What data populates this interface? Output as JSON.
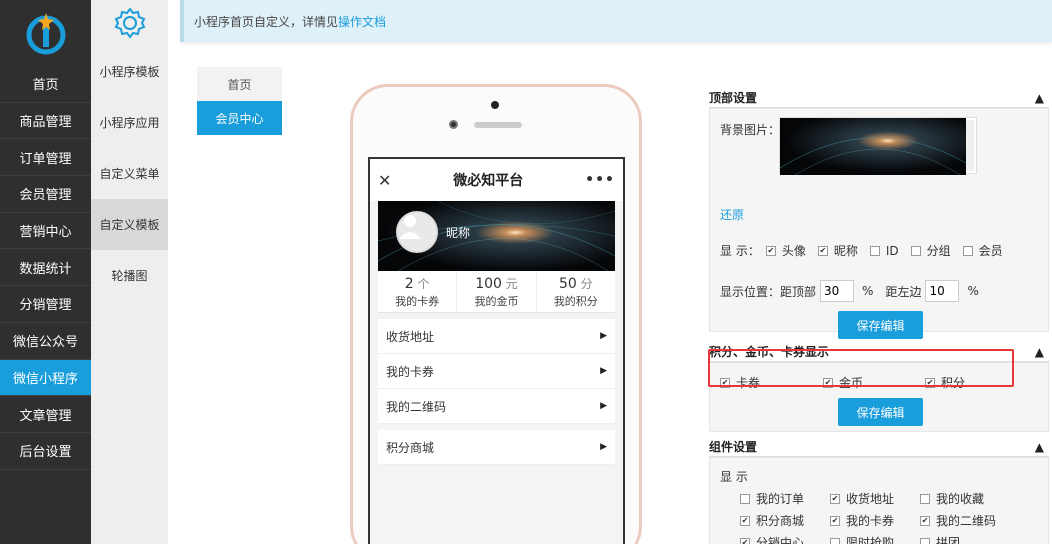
{
  "sidebar": {
    "items": [
      {
        "label": "首页"
      },
      {
        "label": "商品管理"
      },
      {
        "label": "订单管理"
      },
      {
        "label": "会员管理"
      },
      {
        "label": "营销中心"
      },
      {
        "label": "数据统计"
      },
      {
        "label": "分销管理"
      },
      {
        "label": "微信公众号"
      },
      {
        "label": "微信小程序"
      },
      {
        "label": "文章管理"
      },
      {
        "label": "后台设置"
      }
    ]
  },
  "subnav": {
    "items": [
      {
        "label": "小程序模板"
      },
      {
        "label": "小程序应用"
      },
      {
        "label": "自定义菜单"
      },
      {
        "label": "自定义模板"
      },
      {
        "label": "轮播图"
      }
    ]
  },
  "notice": {
    "text": "小程序首页自定义，详情见",
    "link": "操作文档"
  },
  "page_tabs": [
    {
      "label": "首页"
    },
    {
      "label": "会员中心"
    }
  ],
  "preview": {
    "title": "微必知平台",
    "nickname": "昵称",
    "stats": [
      {
        "value": "2",
        "unit": "个",
        "label": "我的卡券"
      },
      {
        "value": "100",
        "unit": "元",
        "label": "我的金币"
      },
      {
        "value": "50",
        "unit": "分",
        "label": "我的积分"
      }
    ],
    "menu": [
      {
        "label": "收货地址"
      },
      {
        "label": "我的卡券"
      },
      {
        "label": "我的二维码"
      },
      {
        "label": "积分商城"
      }
    ]
  },
  "top_settings": {
    "title": "顶部设置",
    "bg_label": "背景图片：",
    "restore": "还原",
    "display_label": "显 示：",
    "display_options": [
      {
        "label": "头像",
        "checked": true
      },
      {
        "label": "昵称",
        "checked": true
      },
      {
        "label": "ID",
        "checked": false
      },
      {
        "label": "分组",
        "checked": false
      },
      {
        "label": "会员",
        "checked": false
      }
    ],
    "position_label": "显示位置：",
    "top_label": "距顶部",
    "top_value": "30",
    "left_label": "距左边",
    "left_value": "10",
    "pct": "%",
    "save": "保存编辑"
  },
  "points_settings": {
    "title": "积分、金币、卡券显示",
    "options": [
      {
        "label": "卡券",
        "checked": true
      },
      {
        "label": "金币",
        "checked": true
      },
      {
        "label": "积分",
        "checked": true
      }
    ],
    "save": "保存编辑"
  },
  "component_settings": {
    "title": "组件设置",
    "display_label": "显 示",
    "options": [
      {
        "label": "我的订单",
        "checked": false
      },
      {
        "label": "收货地址",
        "checked": true
      },
      {
        "label": "我的收藏",
        "checked": false
      },
      {
        "label": "积分商城",
        "checked": true
      },
      {
        "label": "我的卡券",
        "checked": true
      },
      {
        "label": "我的二维码",
        "checked": true
      },
      {
        "label": "分销中心",
        "checked": true
      },
      {
        "label": "限时抢购",
        "checked": false
      },
      {
        "label": "拼团",
        "checked": false
      }
    ]
  },
  "collapse_glyph": "▲",
  "colors": {
    "accent": "#1a9ddb",
    "sidebar": "#2f2f2f",
    "highlight": "#e53935"
  }
}
